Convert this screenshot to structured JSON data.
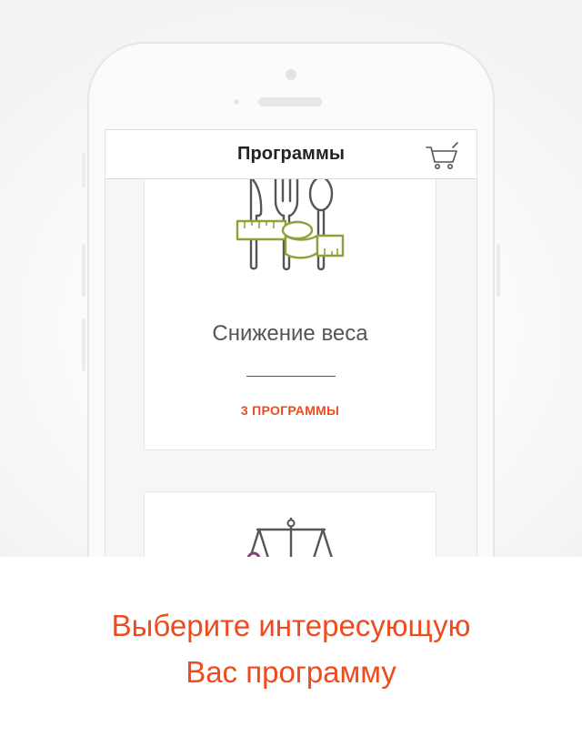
{
  "navbar": {
    "title": "Программы",
    "cart_icon": "shopping-cart-icon"
  },
  "program_cards": [
    {
      "icon": "cutlery-measuring-tape-icon",
      "title": "Снижение веса",
      "count_label": "3 ПРОГРАММЫ"
    },
    {
      "icon": "balance-scale-icon"
    }
  ],
  "caption": {
    "line1": "Выберите интересующую",
    "line2": "Вас программу"
  },
  "colors": {
    "accent": "#ee4b1f",
    "icon_green": "#8da33a",
    "icon_gray": "#555555",
    "icon_purple": "#8a3f75"
  }
}
